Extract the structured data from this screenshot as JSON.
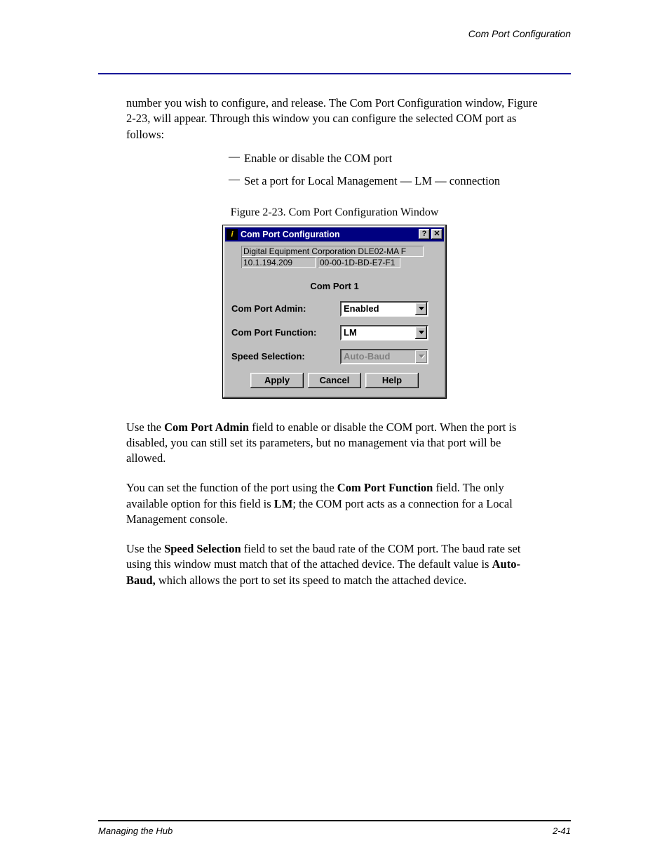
{
  "header": {
    "right_text": "Com Port Configuration"
  },
  "intro": "number you wish to configure, and release. The Com Port Configuration window, Figure 2-23, will appear. Through this window you can configure the selected COM port as follows:",
  "list": [
    "Enable or disable the COM port",
    "Set a port for Local Management — LM — connection"
  ],
  "figure_caption": "Figure 2-23. Com Port Configuration Window",
  "dialog": {
    "title": "Com Port Configuration",
    "device": "Digital Equipment Corporation DLE02-MA F",
    "ip": "10.1.194.209",
    "mac": "00-00-1D-BD-E7-F1",
    "section_title": "Com Port 1",
    "fields": {
      "admin_label": "Com Port Admin:",
      "admin_value": "Enabled",
      "function_label": "Com Port Function:",
      "function_value": "LM",
      "speed_label": "Speed Selection:",
      "speed_value": "Auto-Baud"
    },
    "buttons": {
      "apply": "Apply",
      "cancel": "Cancel",
      "help": "Help"
    }
  },
  "paragraphs": {
    "p1_prefix": "Use the ",
    "p1_bold": "Com Port Admin",
    "p1_suffix": " field to enable or disable the COM port. When the port is disabled, you can still set its parameters, but no management via that port will be allowed.",
    "p2_a": "You can set the function of the port using the ",
    "p2_bold1": "Com Port Function",
    "p2_b": " field. The only available option for this field is ",
    "p2_bold2": "LM",
    "p2_c": "; the COM port acts as a connection for a Local Management console.",
    "p3_a": "Use the ",
    "p3_bold1": "Speed Selection",
    "p3_b": " field to set the baud rate of the COM port. The baud rate set using this window must match that of the attached device. The default value is ",
    "p3_bold2": "Auto-Baud,",
    "p3_c": " which allows the port to set its speed to match the attached device."
  },
  "footer": {
    "left": "Managing the Hub",
    "right": "2-41"
  }
}
